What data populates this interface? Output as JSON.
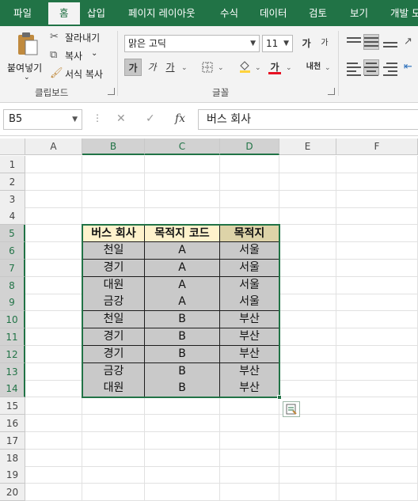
{
  "ribbon_tabs": [
    "파일",
    "홈",
    "삽입",
    "페이지 레이아웃",
    "수식",
    "데이터",
    "검토",
    "보기",
    "개발 도"
  ],
  "active_tab": "홈",
  "clipboard": {
    "paste_label": "붙여넣기",
    "cut_label": "잘라내기",
    "copy_label": "복사",
    "format_painter_label": "서식 복사",
    "group_label": "클립보드"
  },
  "font": {
    "font_name": "맑은 고딕",
    "font_size": "11",
    "grow_label": "가",
    "shrink_label": "가",
    "bold_label": "가",
    "italic_label": "가",
    "underline_label": "가",
    "font_color_label": "가",
    "phonetic_label": "내천",
    "group_label": "글꼴",
    "font_color_hex": "#e81123"
  },
  "formula_bar": {
    "name_box": "B5",
    "cancel_icon": "✕",
    "enter_icon": "✓",
    "fx_label": "fx",
    "formula_value": "버스 회사"
  },
  "grid": {
    "columns": [
      "A",
      "B",
      "C",
      "D",
      "E",
      "F"
    ],
    "rows": [
      "1",
      "2",
      "3",
      "4",
      "5",
      "6",
      "7",
      "8",
      "9",
      "10",
      "11",
      "12",
      "13",
      "14",
      "15",
      "16",
      "17",
      "18",
      "19",
      "20"
    ],
    "selected_columns": [
      "B",
      "C",
      "D"
    ],
    "selected_rows": [
      "5",
      "6",
      "7",
      "8",
      "9",
      "10",
      "11",
      "12",
      "13",
      "14"
    ]
  },
  "table": {
    "headers": [
      "버스 회사",
      "목적지 코드",
      "목적지"
    ],
    "rows": [
      [
        "천일",
        "A",
        "서울"
      ],
      [
        "경기",
        "A",
        "서울"
      ],
      [
        "대원",
        "A",
        "서울"
      ],
      [
        "금강",
        "A",
        "서울"
      ],
      [
        "천일",
        "B",
        "부산"
      ],
      [
        "경기",
        "B",
        "부산"
      ],
      [
        "경기",
        "B",
        "부산"
      ],
      [
        "금강",
        "B",
        "부산"
      ],
      [
        "대원",
        "B",
        "부산"
      ]
    ]
  },
  "colors": {
    "accent": "#217346",
    "header_fill": "#fff2cc",
    "header3_fill": "#ddd3a8",
    "body_fill": "#c9c9c9"
  }
}
